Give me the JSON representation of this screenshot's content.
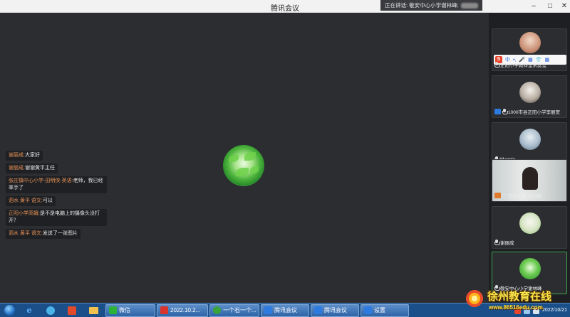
{
  "window": {
    "title": "腾讯会议",
    "speaking_label": "正在讲话: 敬安中心小学谢林峰;",
    "controls": {
      "minimize": "–",
      "maximize": "□",
      "close": "✕"
    }
  },
  "chat": [
    {
      "name": "谢丽成:",
      "text": "大家好"
    },
    {
      "name": "谢丽成:",
      "text": "谢谢黄平主任"
    },
    {
      "name": "张庄镇中心小学-田明侠-英语:",
      "text": "老师，我已经率手了"
    },
    {
      "name": "泗水 黄平 语文:",
      "text": "可以"
    },
    {
      "name": "正阳小学高娥:",
      "text": "是不是电脑上的摄像头没打开？"
    },
    {
      "name": "泗水 黄平 语文:",
      "text": "发送了一张图片"
    }
  ],
  "participants": [
    {
      "label": "正阳小学教科室朱蕊莹",
      "has_ime": true
    },
    {
      "label": "1000市县正阳小学李丽贺",
      "has_user_badge": true
    },
    {
      "label": "Maggie"
    },
    {
      "label": "正阳小学 冯兴敏",
      "video": true,
      "has_user_badge": true
    },
    {
      "label": "谢丽成"
    },
    {
      "label": "敬安中心小学谢林峰",
      "active": true
    }
  ],
  "ime": {
    "logo": "S",
    "mode": "中",
    "items": [
      "•,",
      "🎤",
      "▦",
      "👕",
      "▦"
    ]
  },
  "taskbar": {
    "buttons": [
      {
        "label": "微信",
        "color": "#2fb336"
      },
      {
        "label": "2022.10.2...",
        "color": "#d9342b"
      },
      {
        "label": "一个石一个...",
        "color": "#3aa33a"
      },
      {
        "label": "腾讯会议",
        "color": "#2d7be0"
      },
      {
        "label": "腾讯会议",
        "color": "#2d7be0"
      },
      {
        "label": "设置",
        "color": "#2d7be0"
      }
    ],
    "clock_date": "2022/10/21"
  },
  "watermark": {
    "title": "徐州教育在线",
    "url": "www.86516edu.com"
  },
  "colors": {
    "accent": "#2d7be0",
    "chat_name": "#e8945a",
    "active_border": "#3fa34a"
  }
}
